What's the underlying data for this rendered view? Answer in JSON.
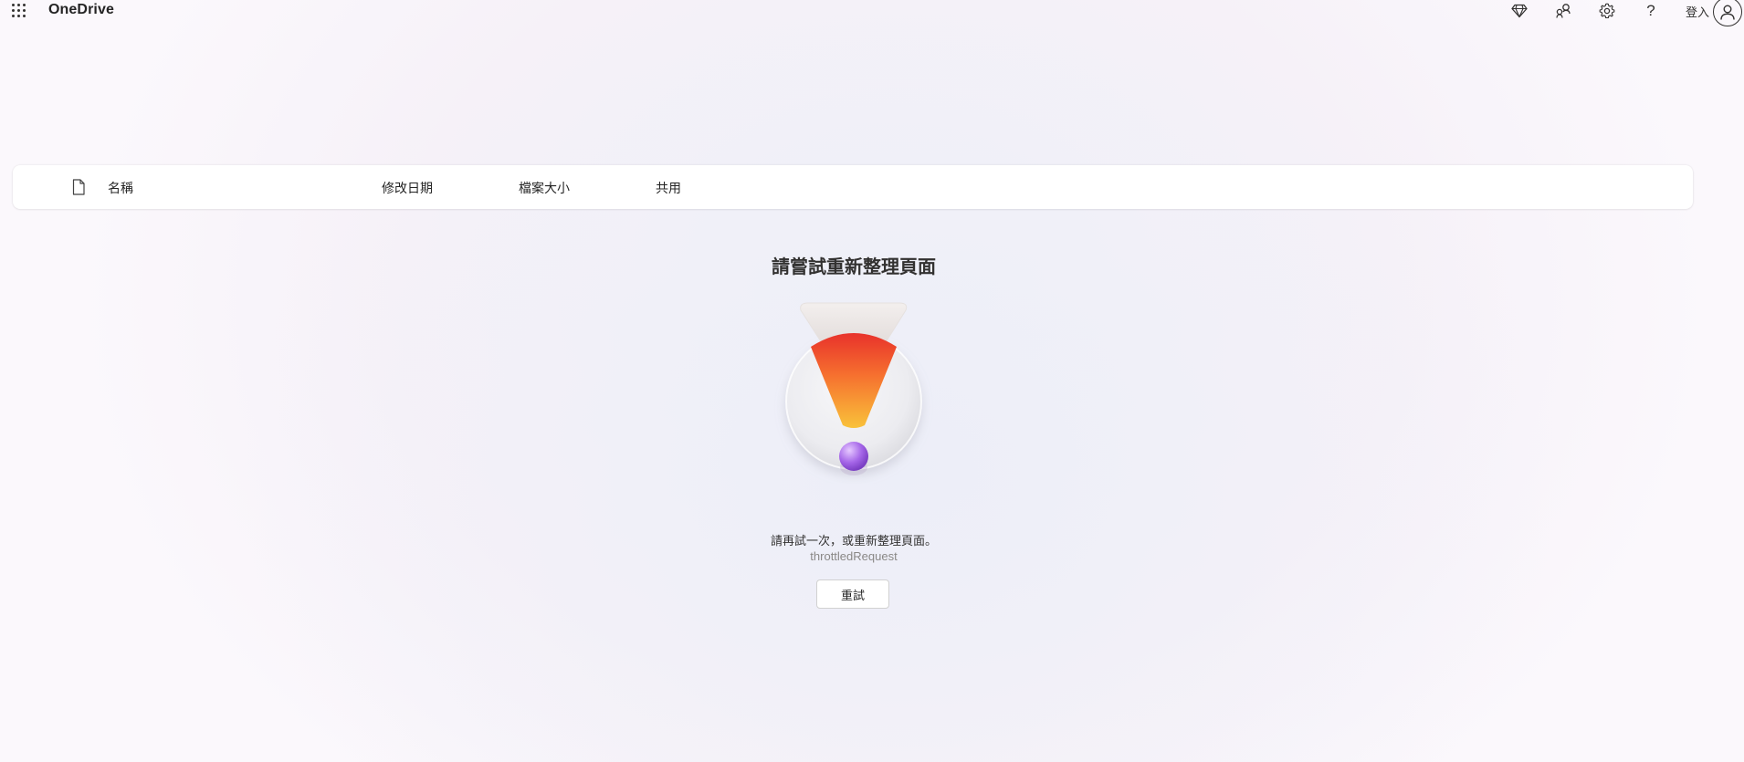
{
  "app": {
    "brand": "OneDrive"
  },
  "topbar": {
    "icons": [
      "premium-diamond-icon",
      "share-connect-icon",
      "gear-icon",
      "help-icon"
    ],
    "help_glyph": "?",
    "signin_label": "登入"
  },
  "list_header": {
    "columns": {
      "name": "名稱",
      "modified": "修改日期",
      "size": "檔案大小",
      "sharing": "共用"
    }
  },
  "error": {
    "title": "請嘗試重新整理頁面",
    "message": "請再試一次，或重新整理頁面。",
    "code": "throttledRequest",
    "retry_label": "重試"
  },
  "colors": {
    "accent_red": "#e8322b",
    "accent_orange": "#f9a03a",
    "accent_purple": "#9b5de5"
  }
}
